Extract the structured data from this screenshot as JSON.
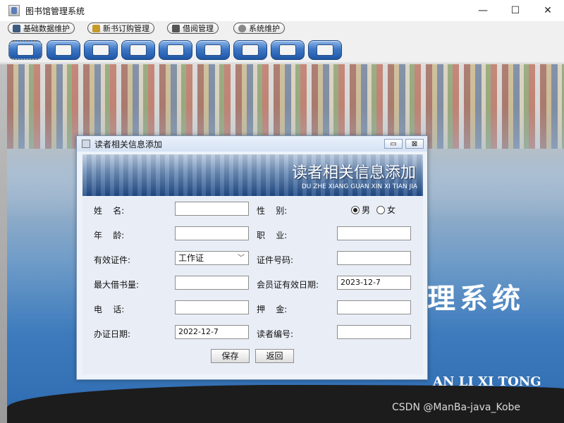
{
  "window": {
    "title": "图书馆管理系统",
    "controls": [
      "—",
      "☐",
      "✕"
    ]
  },
  "menu": [
    {
      "label": "基础数据维护"
    },
    {
      "label": "新书订购管理"
    },
    {
      "label": "借阅管理"
    },
    {
      "label": "系统维护"
    }
  ],
  "toolbar": {
    "buttons": [
      "book",
      "pen",
      "shelf",
      "reader",
      "return",
      "search",
      "display",
      "edit",
      "exit"
    ]
  },
  "background": {
    "title_cn": "理系统",
    "title_en": "AN LI XI TONG",
    "watermark": "CSDN @ManBa-java_Kobe"
  },
  "dialog": {
    "title": "读者相关信息添加",
    "banner_cn": "读者相关信息添加",
    "banner_en": "DU ZHE XIANG GUAN XIN XI TIAN JIA",
    "controls": [
      "▭",
      "⊠"
    ],
    "fields": {
      "name_label": "姓    名:",
      "name_value": "",
      "gender_label": "性    别:",
      "gender_options": [
        "男",
        "女"
      ],
      "gender_selected": "男",
      "age_label": "年    龄:",
      "age_value": "",
      "job_label": "职    业:",
      "job_value": "",
      "idtype_label": "有效证件:",
      "idtype_value": "工作证",
      "idno_label": "证件号码:",
      "idno_value": "",
      "maxborrow_label": "最大借书量:",
      "maxborrow_value": "",
      "expiry_label": "会员证有效日期:",
      "expiry_value": "2023-12-7",
      "phone_label": "电    话:",
      "phone_value": "",
      "deposit_label": "押    金:",
      "deposit_value": "",
      "issue_label": "办证日期:",
      "issue_value": "2022-12-7",
      "readerno_label": "读者编号:",
      "readerno_value": ""
    },
    "buttons": {
      "save": "保存",
      "back": "返回"
    }
  }
}
